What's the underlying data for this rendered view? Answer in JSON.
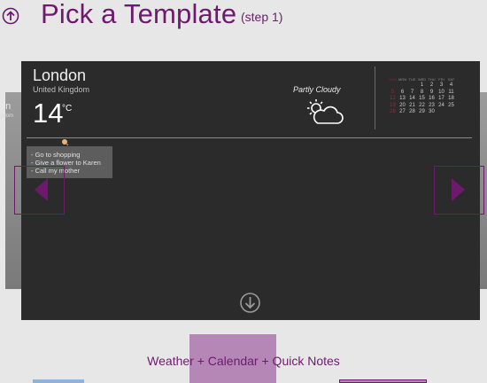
{
  "header": {
    "title": "Pick a Template",
    "step": "(step 1)",
    "back_icon": "circle-up-arrow-icon"
  },
  "side_cards": {
    "left_text1": "on",
    "left_text2": "gdom"
  },
  "weather": {
    "city": "London",
    "country": "United Kingdom",
    "temperature": "14",
    "unit": "°C",
    "condition": "Partly Cloudy",
    "icon": "partly-cloudy-icon"
  },
  "calendar": {
    "days": [
      "SUN",
      "MON",
      "TUE",
      "WED",
      "THU",
      "FRI",
      "SAT"
    ],
    "weeks": [
      [
        "",
        "",
        "",
        "1",
        "2",
        "3",
        "4"
      ],
      [
        "5",
        "6",
        "7",
        "8",
        "9",
        "10",
        "11"
      ],
      [
        "12",
        "13",
        "14",
        "15",
        "16",
        "17",
        "18"
      ],
      [
        "19",
        "20",
        "21",
        "22",
        "23",
        "24",
        "25"
      ],
      [
        "26",
        "27",
        "28",
        "29",
        "30",
        "",
        ""
      ]
    ]
  },
  "notes": {
    "items": [
      "- Go to shopping",
      "- Give a flower to Karen",
      "- Call my mother"
    ]
  },
  "template": {
    "name": "Weather + Calendar + Quick Notes"
  },
  "colors": {
    "accent": "#6d1a6d",
    "card": "#2b2b2b",
    "highlight": "#b487b7",
    "background": "#e7e7e7"
  }
}
